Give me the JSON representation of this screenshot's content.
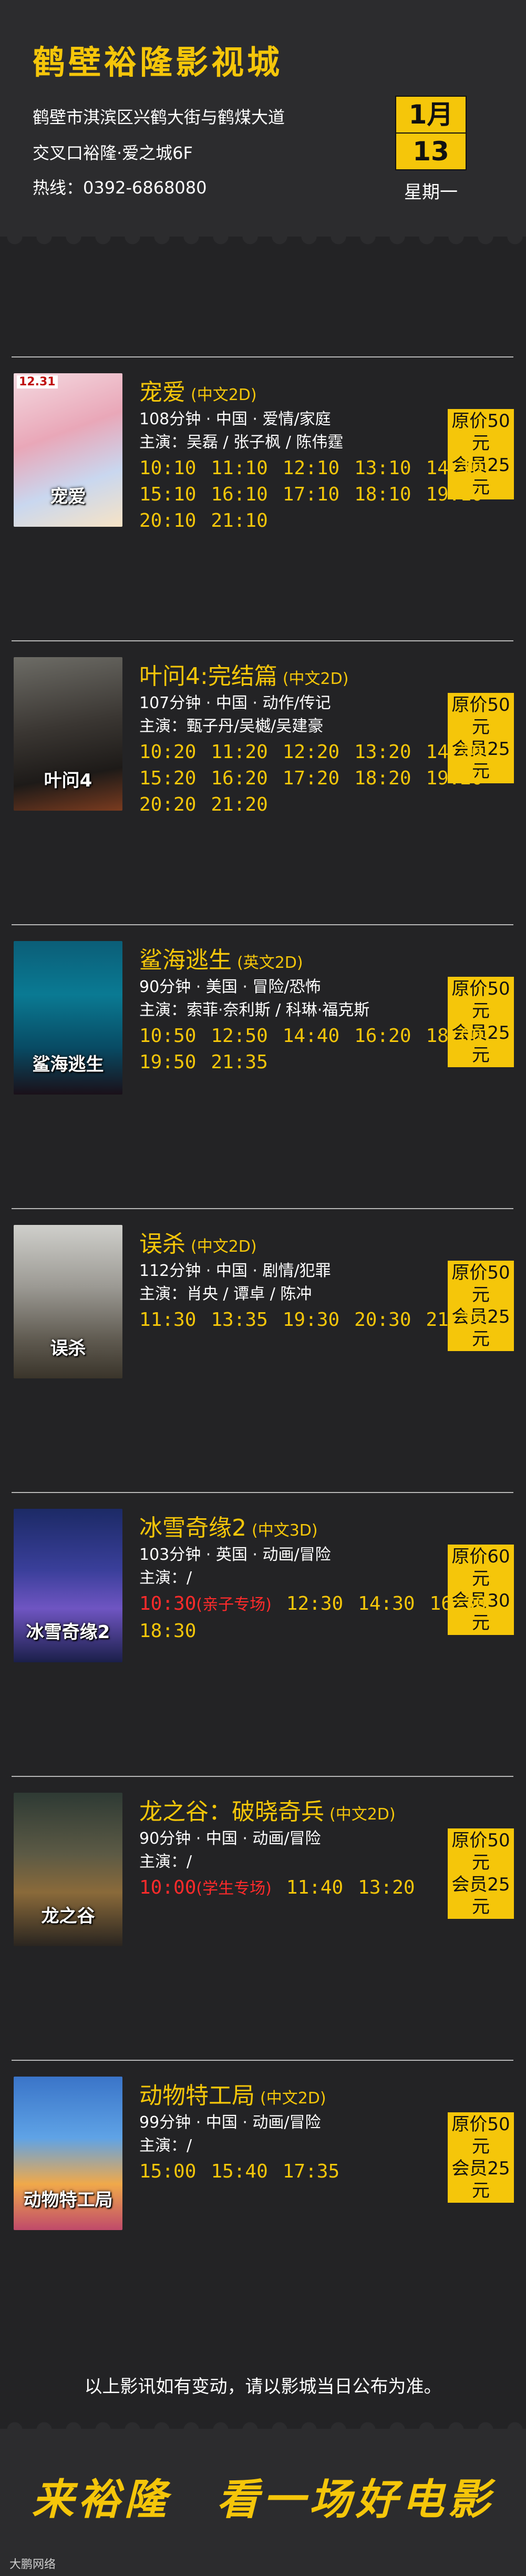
{
  "header": {
    "cinema_name": "鹤壁裕隆影视城",
    "address_line1": "鹤壁市淇滨区兴鹤大街与鹤煤大道",
    "address_line2": "交叉口裕隆·爱之城6F",
    "hotline": "热线：0392-6868080",
    "date_month": "1月",
    "date_day": "13",
    "weekday": "星期一"
  },
  "movies": [
    {
      "title": "宠爱",
      "version": "(中文2D)",
      "info": "108分钟 · 中国 · 爱情/家庭",
      "cast": "主演：吴磊 / 张子枫 / 陈伟霆",
      "price_original": "原价50元",
      "price_member": "会员25元",
      "poster_text": "宠爱",
      "poster_label": "12.31",
      "times": [
        "10:10",
        "11:10",
        "12:10",
        "13:10",
        "14:10",
        "15:10",
        "16:10",
        "17:10",
        "18:10",
        "19:10",
        "20:10",
        "21:10"
      ]
    },
    {
      "title": "叶问4:完结篇",
      "version": "(中文2D)",
      "info": "107分钟 · 中国 · 动作/传记",
      "cast": "主演：甄子丹/吴樾/吴建豪",
      "price_original": "原价50元",
      "price_member": "会员25元",
      "poster_text": "叶问4",
      "times": [
        "10:20",
        "11:20",
        "12:20",
        "13:20",
        "14:20",
        "15:20",
        "16:20",
        "17:20",
        "18:20",
        "19:20",
        "20:20",
        "21:20"
      ]
    },
    {
      "title": "鲨海逃生",
      "version": "(英文2D)",
      "info": "90分钟 · 美国 · 冒险/恐怖",
      "cast": "主演：索菲·奈利斯 / 科琳·福克斯",
      "price_original": "原价50元",
      "price_member": "会员25元",
      "poster_text": "鲨海逃生",
      "times": [
        "10:50",
        "12:50",
        "14:40",
        "16:20",
        "18:00",
        "19:50",
        "21:35"
      ]
    },
    {
      "title": "误杀",
      "version": "(中文2D)",
      "info": "112分钟 · 中国 · 剧情/犯罪",
      "cast": "主演：肖央 / 谭卓 / 陈冲",
      "price_original": "原价50元",
      "price_member": "会员25元",
      "poster_text": "误杀",
      "times": [
        "11:30",
        "13:35",
        "19:30",
        "20:30",
        "21:35"
      ]
    },
    {
      "title": "冰雪奇缘2",
      "version": "(中文3D)",
      "info": "103分钟 · 英国 · 动画/冒险",
      "cast": "主演：/",
      "price_original": "原价60元",
      "price_member": "会员30元",
      "poster_text": "冰雪奇缘2",
      "special_time": "10:30",
      "special_label": "(亲子专场)",
      "times": [
        "10:30",
        "12:30",
        "14:30",
        "16:30",
        "18:30"
      ]
    },
    {
      "title": "龙之谷：破晓奇兵",
      "version": "(中文2D)",
      "info": "90分钟 · 中国 · 动画/冒险",
      "cast": "主演：/",
      "price_original": "原价50元",
      "price_member": "会员25元",
      "poster_text": "龙之谷",
      "special_time": "10:00",
      "special_label": "(学生专场)",
      "times": [
        "11:40",
        "13:20"
      ]
    },
    {
      "title": "动物特工局",
      "version": "(中文2D)",
      "info": "99分钟 · 中国 · 动画/冒险",
      "cast": "主演：/",
      "price_original": "原价50元",
      "price_member": "会员25元",
      "poster_text": "动物特工局",
      "times": [
        "15:00",
        "15:40",
        "17:35"
      ]
    }
  ],
  "notice": "以上影讯如有变动，请以影城当日公布为准。",
  "footer": {
    "slogan": "来裕隆　看一场好电影",
    "watermark": "大鹏网络"
  },
  "colors": {
    "accent": "#f5c60a",
    "background": "#232325",
    "special": "#ff2b2b"
  }
}
